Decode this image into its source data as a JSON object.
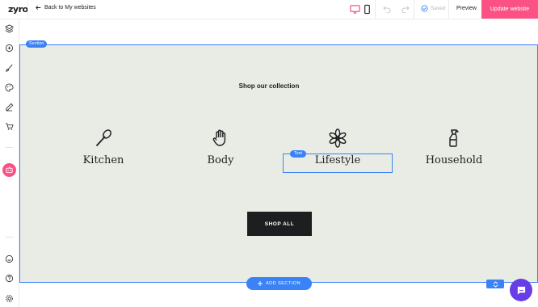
{
  "header": {
    "logo": "zyro",
    "back_label": "Back to My websites",
    "saved_label": "Saved",
    "preview_label": "Preview",
    "update_label": "Update website"
  },
  "colors": {
    "accent": "#fc5185",
    "selection": "#3b82f6",
    "section_bg": "#e9ece4",
    "button_dark": "#1d1e20",
    "chat": "#673de6"
  },
  "sidebar": {
    "icons": [
      "layers-icon",
      "add-icon",
      "brush-icon",
      "palette-icon",
      "pen-icon",
      "cart-icon",
      "ai-robot-icon",
      "smiley-icon",
      "help-icon",
      "settings-icon"
    ]
  },
  "section": {
    "tag": "Section",
    "title": "Shop our collection",
    "text_tag": "Text",
    "categories": [
      {
        "label": "Kitchen",
        "icon": "spoon-icon"
      },
      {
        "label": "Body",
        "icon": "hand-icon"
      },
      {
        "label": "Lifestyle",
        "icon": "flower-icon"
      },
      {
        "label": "Household",
        "icon": "spray-bottle-icon"
      }
    ],
    "cta_label": "SHOP ALL"
  },
  "footer_controls": {
    "add_section_label": "ADD SECTION"
  }
}
